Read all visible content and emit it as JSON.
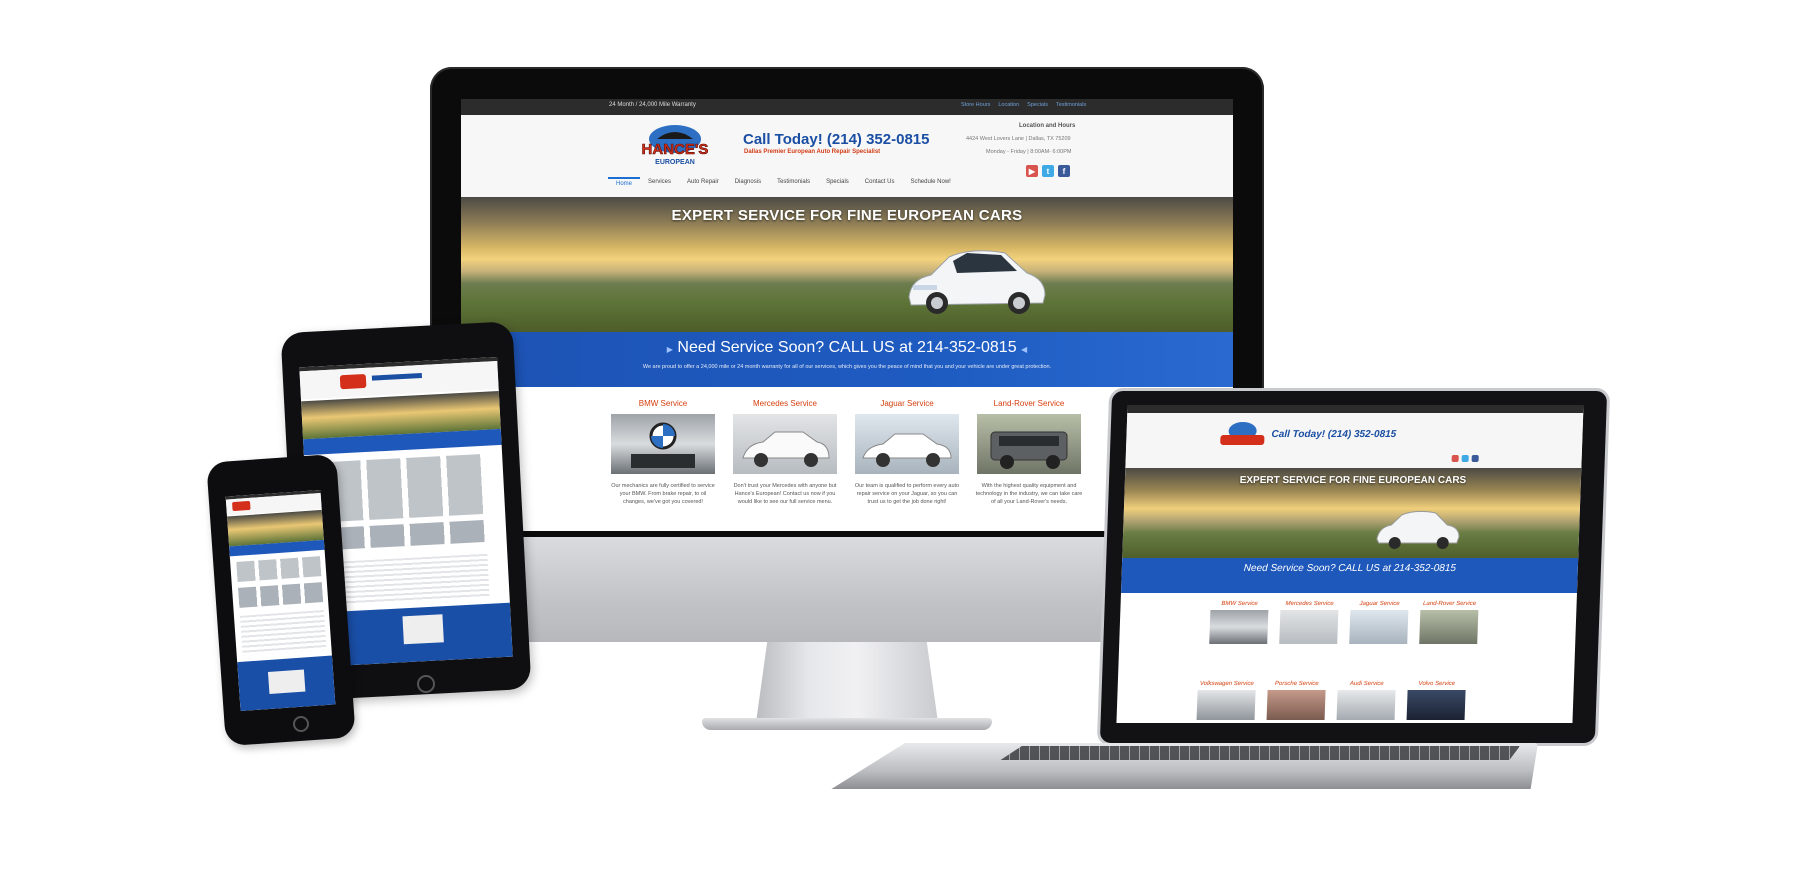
{
  "site": {
    "warranty": "24 Month / 24,000 Mile Warranty",
    "top_links": [
      "Store Hours",
      "Location",
      "Specials",
      "Testimonials"
    ],
    "logo_line1": "HANCE'S",
    "logo_line2": "EUROPEAN",
    "call_today": "Call Today! (214) 352-0815",
    "tagline": "Dallas Premier European Auto Repair Specialist",
    "location_title": "Location and Hours",
    "address": "4424 West Lovers Lane | Dallas, TX 75209",
    "hours": "Monday - Friday | 8:00AM- 6:00PM",
    "nav": [
      "Home",
      "Services",
      "Auto Repair",
      "Diagnosis",
      "Testimonials",
      "Specials",
      "Contact Us",
      "Schedule Now!"
    ],
    "hero_title": "EXPERT SERVICE FOR FINE EUROPEAN CARS",
    "band_title": "Need Service Soon? CALL US at 214-352-0815",
    "band_sub": "We are proud to offer a 24,000 mile or 24 month warranty for all of our services, which gives you the peace of mind that you and your vehicle are under great protection.",
    "services": [
      {
        "title": "BMW Service",
        "desc": "Our mechanics are fully certified to service your BMW. From brake repair, to oil changes, we've got you covered!"
      },
      {
        "title": "Mercedes Service",
        "desc": "Don't trust your Mercedes with anyone but Hance's European! Contact us now if you would like to see our full service menu."
      },
      {
        "title": "Jaguar Service",
        "desc": "Our team is qualified to perform every auto repair service on your Jaguar, so you can trust us to get the job done right!"
      },
      {
        "title": "Land-Rover Service",
        "desc": "With the highest quality equipment and technology in the industry, we can take care of all your Land-Rover's needs."
      }
    ]
  },
  "laptop": {
    "call_today": "Call Today! (214) 352-0815",
    "hero_title": "EXPERT SERVICE FOR FINE EUROPEAN CARS",
    "band_title": "Need Service Soon? CALL US at 214-352-0815",
    "services_row1": [
      "BMW Service",
      "Mercedes Service",
      "Jaguar Service",
      "Land-Rover Service"
    ],
    "services_row2": [
      "Volkswagen Service",
      "Porsche Service",
      "Audi Service",
      "Volvo Service"
    ]
  },
  "icons": [
    "youtube-icon",
    "twitter-icon",
    "facebook-icon",
    "arrow-right-icon",
    "arrow-left-icon"
  ],
  "colors": {
    "brand_blue": "#1e5bc1",
    "accent_orange": "#d4400f",
    "dark_bar": "#2c2c2c"
  }
}
